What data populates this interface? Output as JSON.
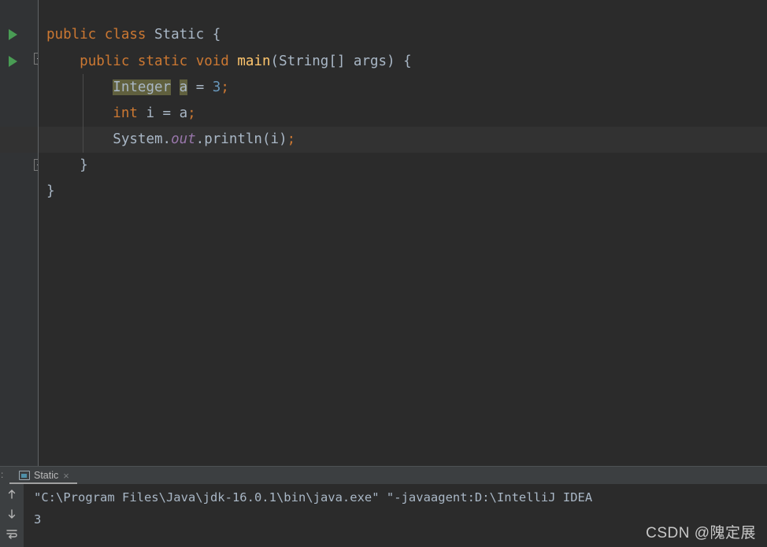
{
  "editor": {
    "background_color": "#2b2b2b",
    "gutter_color": "#313335",
    "current_line_color": "#323232",
    "lines": [
      {
        "n": 1,
        "run_marker": true,
        "fold": "none",
        "tokens": [
          {
            "t": "public",
            "c": "kw"
          },
          {
            "t": " ",
            "c": "punct"
          },
          {
            "t": "class",
            "c": "kw"
          },
          {
            "t": " ",
            "c": "punct"
          },
          {
            "t": "Static",
            "c": "ident"
          },
          {
            "t": " {",
            "c": "punct"
          }
        ]
      },
      {
        "n": 2,
        "run_marker": true,
        "fold": "open",
        "tokens": [
          {
            "t": "    ",
            "c": "punct"
          },
          {
            "t": "public",
            "c": "kw"
          },
          {
            "t": " ",
            "c": "punct"
          },
          {
            "t": "static",
            "c": "kw"
          },
          {
            "t": " ",
            "c": "punct"
          },
          {
            "t": "void",
            "c": "kw"
          },
          {
            "t": " ",
            "c": "punct"
          },
          {
            "t": "main",
            "c": "method"
          },
          {
            "t": "(",
            "c": "punct"
          },
          {
            "t": "String",
            "c": "ident"
          },
          {
            "t": "[] ",
            "c": "punct"
          },
          {
            "t": "args",
            "c": "ident"
          },
          {
            "t": ") {",
            "c": "punct"
          }
        ]
      },
      {
        "n": 3,
        "run_marker": false,
        "fold": "none",
        "tokens": [
          {
            "t": "        ",
            "c": "punct"
          },
          {
            "t": "Integer",
            "c": "ident hl-a"
          },
          {
            "t": " ",
            "c": "punct"
          },
          {
            "t": "a",
            "c": "ident hl-b"
          },
          {
            "t": " = ",
            "c": "punct"
          },
          {
            "t": "3",
            "c": "num"
          },
          {
            "t": ";",
            "c": "semi"
          }
        ]
      },
      {
        "n": 4,
        "run_marker": false,
        "fold": "none",
        "tokens": [
          {
            "t": "        ",
            "c": "punct"
          },
          {
            "t": "int",
            "c": "kw"
          },
          {
            "t": " ",
            "c": "punct"
          },
          {
            "t": "i",
            "c": "ident"
          },
          {
            "t": " = ",
            "c": "punct"
          },
          {
            "t": "a",
            "c": "ident"
          },
          {
            "t": ";",
            "c": "semi"
          }
        ]
      },
      {
        "n": 5,
        "run_marker": false,
        "fold": "none",
        "current": true,
        "tokens": [
          {
            "t": "        ",
            "c": "punct"
          },
          {
            "t": "System",
            "c": "ident"
          },
          {
            "t": ".",
            "c": "punct"
          },
          {
            "t": "out",
            "c": "staticf"
          },
          {
            "t": ".",
            "c": "punct"
          },
          {
            "t": "println",
            "c": "ident"
          },
          {
            "t": "(",
            "c": "punct"
          },
          {
            "t": "i",
            "c": "ident"
          },
          {
            "t": ")",
            "c": "punct"
          },
          {
            "t": ";",
            "c": "semi"
          }
        ]
      },
      {
        "n": 6,
        "run_marker": false,
        "fold": "close",
        "tokens": [
          {
            "t": "    ",
            "c": "punct"
          },
          {
            "t": "}",
            "c": "punct"
          }
        ]
      },
      {
        "n": 7,
        "run_marker": false,
        "fold": "none",
        "tokens": [
          {
            "t": "}",
            "c": "punct"
          }
        ]
      }
    ]
  },
  "console": {
    "tab_prefix": ":",
    "tab_label": "Static",
    "tab_close": "×",
    "toolbar": {
      "up_tooltip": "Up the stack trace",
      "down_tooltip": "Down the stack trace",
      "wrap_tooltip": "Use Soft Wraps"
    },
    "output_lines": [
      "\"C:\\Program Files\\Java\\jdk-16.0.1\\bin\\java.exe\" \"-javaagent:D:\\IntelliJ IDEA ",
      "3"
    ]
  },
  "watermark": {
    "text": "CSDN @隗定展"
  }
}
